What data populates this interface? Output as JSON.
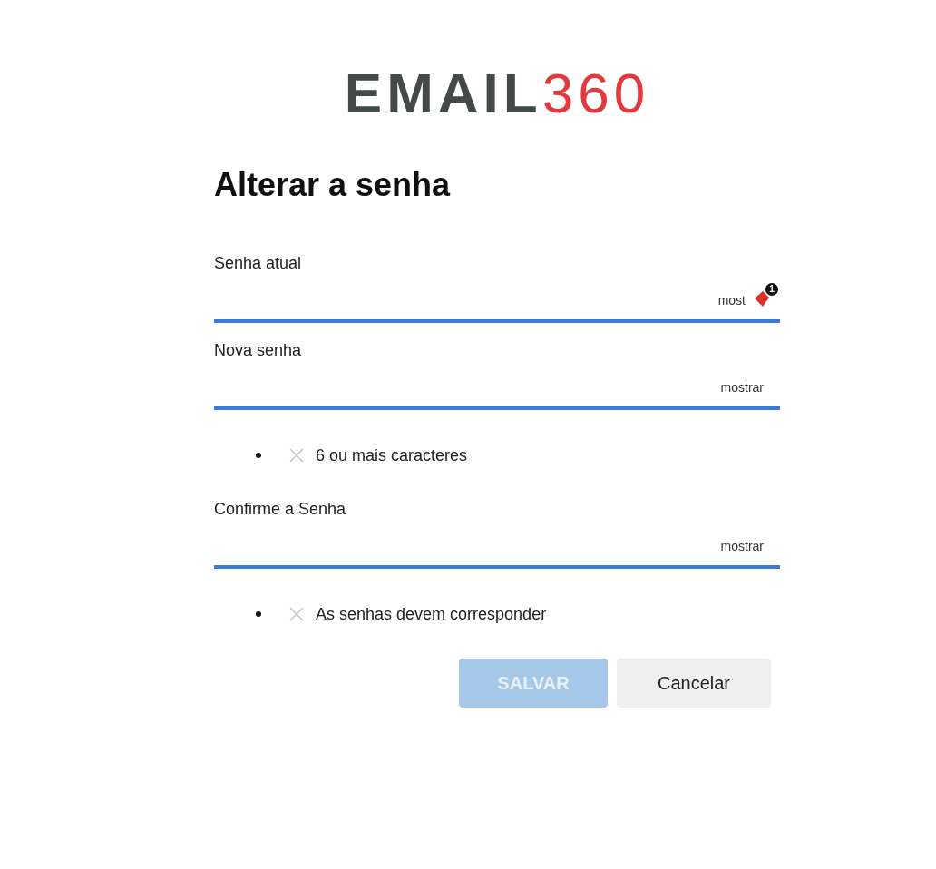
{
  "logo": {
    "word": "EMAIL",
    "number": "360"
  },
  "title": "Alterar a senha",
  "form": [
    {
      "kind": "field",
      "label": "Senha atual",
      "toggle": "most",
      "extension_badge": "1"
    },
    {
      "kind": "field",
      "label": "Nova senha",
      "toggle": "mostrar"
    },
    {
      "kind": "rule",
      "text": "6 ou mais caracteres",
      "met": false
    },
    {
      "kind": "field",
      "label": "Confirme a Senha",
      "toggle": "mostrar"
    },
    {
      "kind": "rule",
      "text": "As senhas devem corresponder",
      "met": false
    }
  ],
  "buttons": [
    {
      "kind": "primary",
      "label": "SALVAR",
      "disabled": true
    },
    {
      "kind": "secondary",
      "label": "Cancelar",
      "disabled": false
    }
  ]
}
